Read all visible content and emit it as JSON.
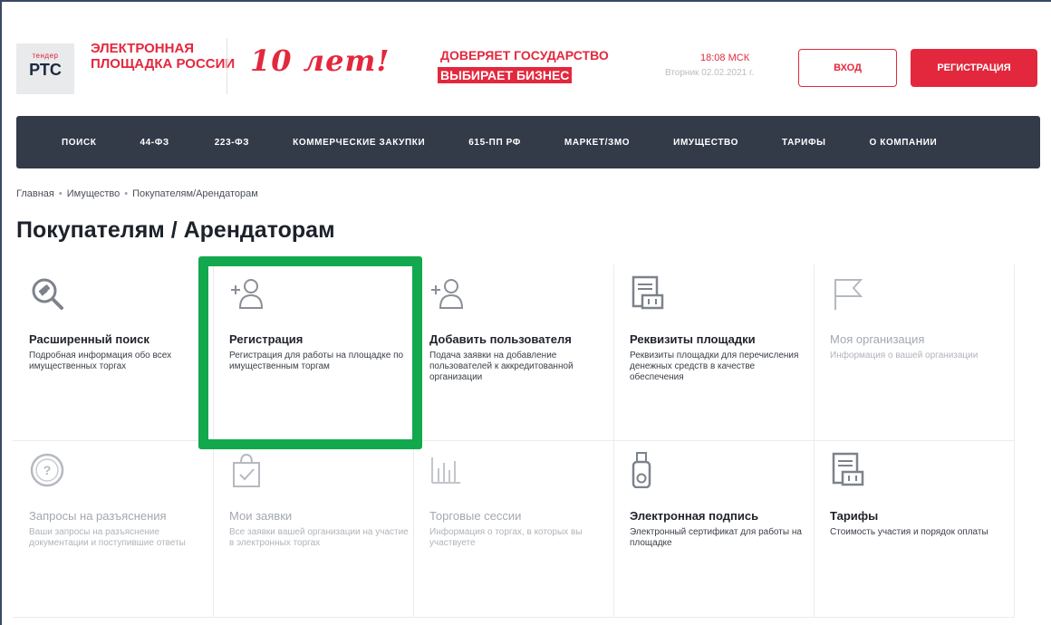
{
  "header": {
    "logo_small": "тендер",
    "logo_big": "РТС",
    "logo_text": "ЭЛЕКТРОННАЯ ПЛОЩАДКА РОССИИ",
    "anniversary": "10 лет!",
    "trust_line1": "ДОВЕРЯЕТ ГОСУДАРСТВО",
    "trust_line2": "ВЫБИРАЕТ БИЗНЕС",
    "time": "18:08 МСК",
    "date": "Вторник 02.02.2021 г.",
    "login_label": "ВХОД",
    "register_label": "РЕГИСТРАЦИЯ"
  },
  "nav": {
    "items": [
      "ПОИСК",
      "44-ФЗ",
      "223-ФЗ",
      "КОММЕРЧЕСКИЕ ЗАКУПКИ",
      "615-ПП РФ",
      "МАРКЕТ/ЗМО",
      "ИМУЩЕСТВО",
      "ТАРИФЫ",
      "О КОМПАНИИ"
    ]
  },
  "breadcrumb": [
    "Главная",
    "Имущество",
    "Покупателям/Арендаторам"
  ],
  "page_title": "Покупателям / Арендаторам",
  "cards": [
    {
      "title": "Расширенный поиск",
      "desc": "Подробная информация обо всех имущественных торгах",
      "icon": "search-gavel-icon"
    },
    {
      "title": "Регистрация",
      "desc": "Регистрация для работы на площадке по имущественным торгам",
      "icon": "add-user-icon"
    },
    {
      "title": "Добавить пользователя",
      "desc": "Подача заявки на добавление пользователей к аккредитованной организации",
      "icon": "add-user-icon"
    },
    {
      "title": "Реквизиты площадки",
      "desc": "Реквизиты площадки для перечисления денежных средств в качестве обеспечения",
      "icon": "document-money-icon"
    },
    {
      "title": "Моя организация",
      "desc": "Информация о вашей организации",
      "icon": "flag-icon"
    },
    {
      "title": "Запросы на разъяснения",
      "desc": "Ваши запросы на разъяснение документации и поступившие ответы",
      "icon": "question-icon"
    },
    {
      "title": "Мои заявки",
      "desc": "Все заявки вашей организации на участие в электронных торгах",
      "icon": "bag-check-icon"
    },
    {
      "title": "Торговые сессии",
      "desc": "Информация о торгах, в которых вы участвуете",
      "icon": "bar-chart-icon"
    },
    {
      "title": "Электронная подпись",
      "desc": "Электронный сертификат для работы на площадке",
      "icon": "usb-token-icon"
    },
    {
      "title": "Тарифы",
      "desc": "Стоимость участия и порядок оплаты",
      "icon": "document-money-icon"
    }
  ],
  "colors": {
    "brand_red": "#e3283d",
    "nav_bg": "#333a48",
    "highlight_green": "#12a84d"
  }
}
